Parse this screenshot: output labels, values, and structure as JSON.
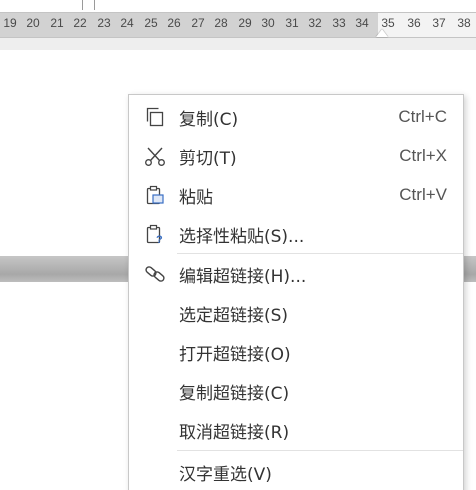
{
  "ruler": {
    "numbers": [
      "19",
      "20",
      "21",
      "22",
      "23",
      "24",
      "25",
      "26",
      "27",
      "28",
      "29",
      "30",
      "31",
      "32",
      "33",
      "34",
      "35",
      "36",
      "37",
      "38"
    ]
  },
  "context_menu": {
    "items": [
      {
        "label": "复制(C)",
        "shortcut": "Ctrl+C",
        "icon": "copy-icon"
      },
      {
        "label": "剪切(T)",
        "shortcut": "Ctrl+X",
        "icon": "scissors-icon"
      },
      {
        "label": "粘贴",
        "shortcut": "Ctrl+V",
        "icon": "paste-icon"
      },
      {
        "label": "选择性粘贴(S)...",
        "shortcut": "",
        "icon": "paste-special-icon"
      },
      {
        "label": "编辑超链接(H)...",
        "shortcut": "",
        "icon": "link-icon"
      },
      {
        "label": "选定超链接(S)",
        "shortcut": "",
        "icon": ""
      },
      {
        "label": "打开超链接(O)",
        "shortcut": "",
        "icon": ""
      },
      {
        "label": "复制超链接(C)",
        "shortcut": "",
        "icon": ""
      },
      {
        "label": "取消超链接(R)",
        "shortcut": "",
        "icon": ""
      },
      {
        "label": "汉字重选(V)",
        "shortcut": "",
        "icon": ""
      }
    ]
  }
}
